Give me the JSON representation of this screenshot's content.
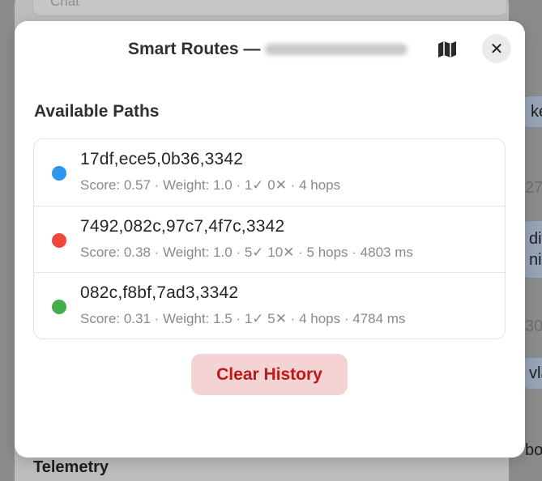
{
  "background": {
    "chat_label": "Chat",
    "telemetry_label": "Telemetry",
    "right_fragments": [
      "ke",
      "27",
      "div",
      "nit",
      "30",
      "vla",
      "bo"
    ]
  },
  "modal": {
    "title": "Smart Routes —",
    "map_icon": "map-icon",
    "close_icon": "close-icon",
    "close_glyph": "✕",
    "section_title": "Available Paths",
    "paths": [
      {
        "name": "17df,ece5,0b36,3342",
        "meta": "Score: 0.57 · Weight: 1.0 · 1✓ 0✕ · 4 hops",
        "color": "#2e96f0"
      },
      {
        "name": "7492,082c,97c7,4f7c,3342",
        "meta": "Score: 0.38 · Weight: 1.0 · 5✓ 10✕ · 5 hops · 4803 ms",
        "color": "#f0473a"
      },
      {
        "name": "082c,f8bf,7ad3,3342",
        "meta": "Score: 0.31 · Weight: 1.5 · 1✓ 5✕ · 4 hops · 4784 ms",
        "color": "#46ad4c"
      }
    ],
    "clear_label": "Clear History"
  }
}
